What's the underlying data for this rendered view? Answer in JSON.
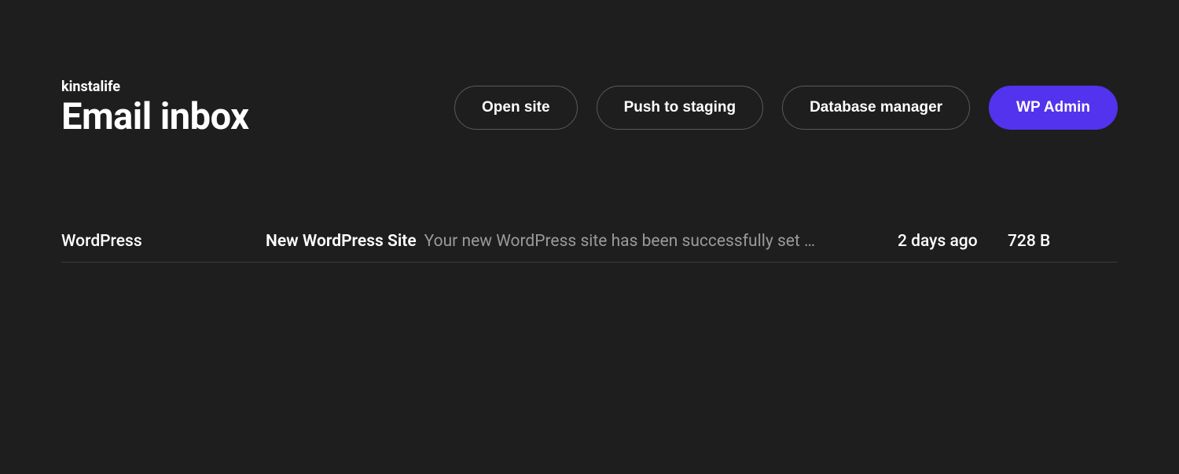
{
  "header": {
    "breadcrumb": "kinstalife",
    "title": "Email inbox",
    "actions": {
      "open_site": "Open site",
      "push_to_staging": "Push to staging",
      "database_manager": "Database manager",
      "wp_admin": "WP Admin"
    }
  },
  "emails": [
    {
      "sender": "WordPress",
      "subject": "New WordPress Site",
      "preview": "Your new WordPress site has been successfully set …",
      "time": "2 days ago",
      "size": "728 B"
    }
  ]
}
